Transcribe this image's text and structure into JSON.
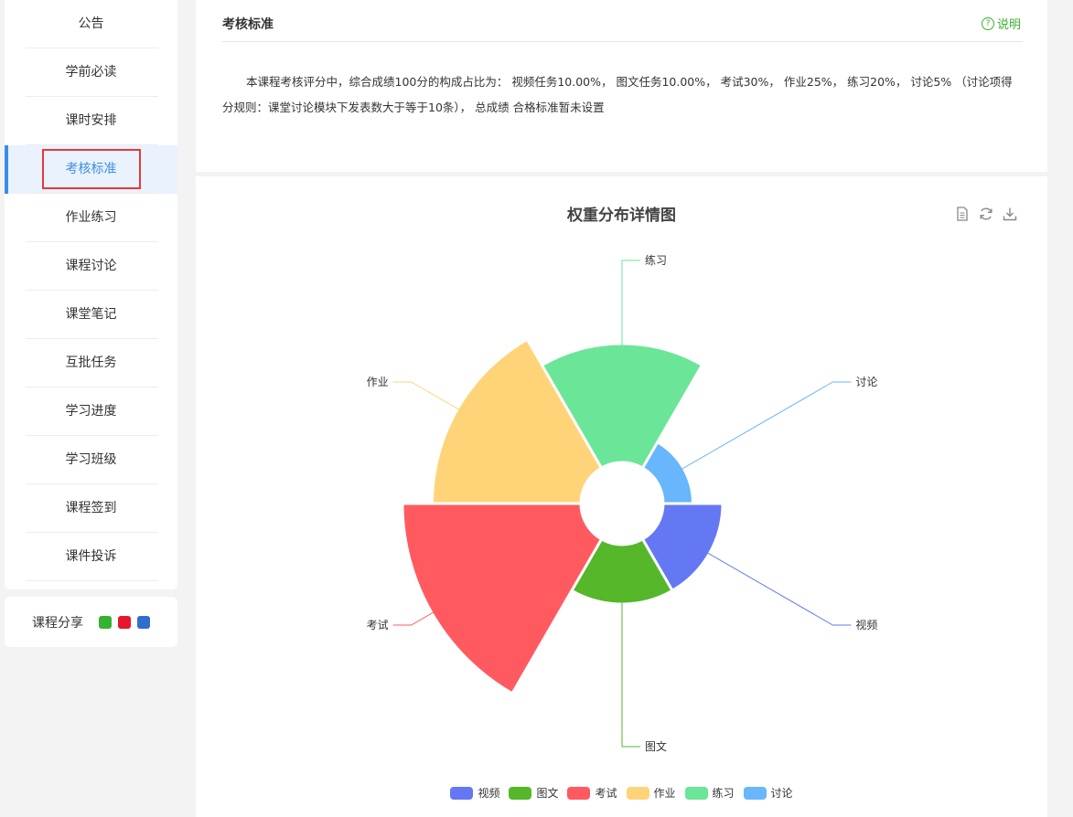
{
  "sidebar": {
    "items": [
      {
        "label": "公告"
      },
      {
        "label": "学前必读"
      },
      {
        "label": "课时安排"
      },
      {
        "label": "考核标准"
      },
      {
        "label": "作业练习"
      },
      {
        "label": "课程讨论"
      },
      {
        "label": "课堂笔记"
      },
      {
        "label": "互批任务"
      },
      {
        "label": "学习进度"
      },
      {
        "label": "学习班级"
      },
      {
        "label": "课程签到"
      },
      {
        "label": "课件投诉"
      }
    ],
    "active_index": 3,
    "share_label": "课程分享",
    "share_icons": [
      "wechat-icon",
      "weibo-icon",
      "qq-icon"
    ]
  },
  "panel": {
    "title": "考核标准",
    "help_label": "说明",
    "description": "本课程考核评分中，综合成绩100分的构成占比为： 视频任务10.00%， 图文任务10.00%， 考试30%， 作业25%， 练习20%， 讨论5% （讨论项得分规则：课堂讨论模块下发表数大于等于10条）， 总成绩 合格标准暂未设置"
  },
  "chart_data": {
    "type": "pie",
    "rose_type": "radius",
    "title": "权重分布详情图",
    "series": [
      {
        "name": "视频",
        "value": 10,
        "color": "#6478f4"
      },
      {
        "name": "图文",
        "value": 10,
        "color": "#55b729"
      },
      {
        "name": "考试",
        "value": 30,
        "color": "#ff5a60"
      },
      {
        "name": "作业",
        "value": 25,
        "color": "#ffd478"
      },
      {
        "name": "练习",
        "value": 20,
        "color": "#6be597"
      },
      {
        "name": "讨论",
        "value": 5,
        "color": "#68b6fb"
      }
    ],
    "legend_position": "bottom-center",
    "toolbox": [
      "data-view-icon",
      "restore-icon",
      "save-image-icon"
    ]
  }
}
